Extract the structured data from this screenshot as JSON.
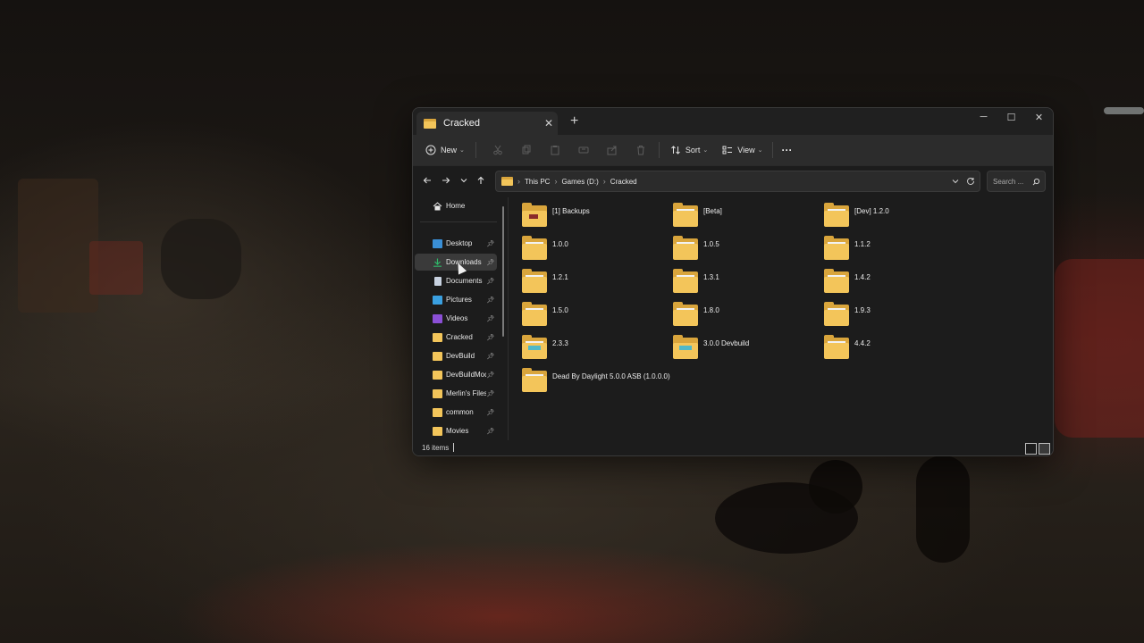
{
  "colors": {
    "folder_yellow": "#f3c55a",
    "folder_dark": "#d9a53c",
    "window_bg": "#1c1c1c",
    "toolbar_bg": "#2c2c2c",
    "accent_green": "#2fb869"
  },
  "window": {
    "tab_title": "Cracked",
    "tab_close": "✕",
    "tab_add": "+",
    "controls": {
      "minimize": "─",
      "maximize": "☐",
      "close": "✕"
    }
  },
  "toolbar": {
    "new_label": "New",
    "sort_label": "Sort",
    "view_label": "View",
    "more_label": "···",
    "icons": [
      "cut-icon",
      "copy-icon",
      "paste-icon",
      "rename-icon",
      "share-icon",
      "delete-icon"
    ]
  },
  "navigation": {
    "breadcrumb": [
      "This PC",
      "Games (D:)",
      "Cracked"
    ],
    "search_placeholder": "Search ..."
  },
  "sidebar": {
    "home": "Home",
    "items": [
      {
        "label": "Desktop",
        "icon": "desktop-icon"
      },
      {
        "label": "Downloads",
        "icon": "download-icon"
      },
      {
        "label": "Documents",
        "icon": "document-icon"
      },
      {
        "label": "Pictures",
        "icon": "pictures-icon"
      },
      {
        "label": "Videos",
        "icon": "videos-icon"
      },
      {
        "label": "Cracked",
        "icon": "folder-icon"
      },
      {
        "label": "DevBuild",
        "icon": "folder-icon"
      },
      {
        "label": "DevBuildMod",
        "icon": "folder-icon"
      },
      {
        "label": "Merlin's Files",
        "icon": "folder-icon"
      },
      {
        "label": "common",
        "icon": "folder-icon"
      },
      {
        "label": "Movies",
        "icon": "folder-icon"
      }
    ],
    "selected": "Downloads"
  },
  "folders": [
    {
      "name": "[1] Backups"
    },
    {
      "name": "[Beta]"
    },
    {
      "name": "[Dev] 1.2.0"
    },
    {
      "name": "1.0.0"
    },
    {
      "name": "1.0.5"
    },
    {
      "name": "1.1.2"
    },
    {
      "name": "1.2.1"
    },
    {
      "name": "1.3.1"
    },
    {
      "name": "1.4.2"
    },
    {
      "name": "1.5.0"
    },
    {
      "name": "1.8.0"
    },
    {
      "name": "1.9.3"
    },
    {
      "name": "2.3.3"
    },
    {
      "name": "3.0.0 Devbuild"
    },
    {
      "name": "4.4.2"
    },
    {
      "name": "Dead By Daylight 5.0.0 ASB (1.0.0.0)"
    }
  ],
  "status": {
    "item_count": "16 items"
  }
}
